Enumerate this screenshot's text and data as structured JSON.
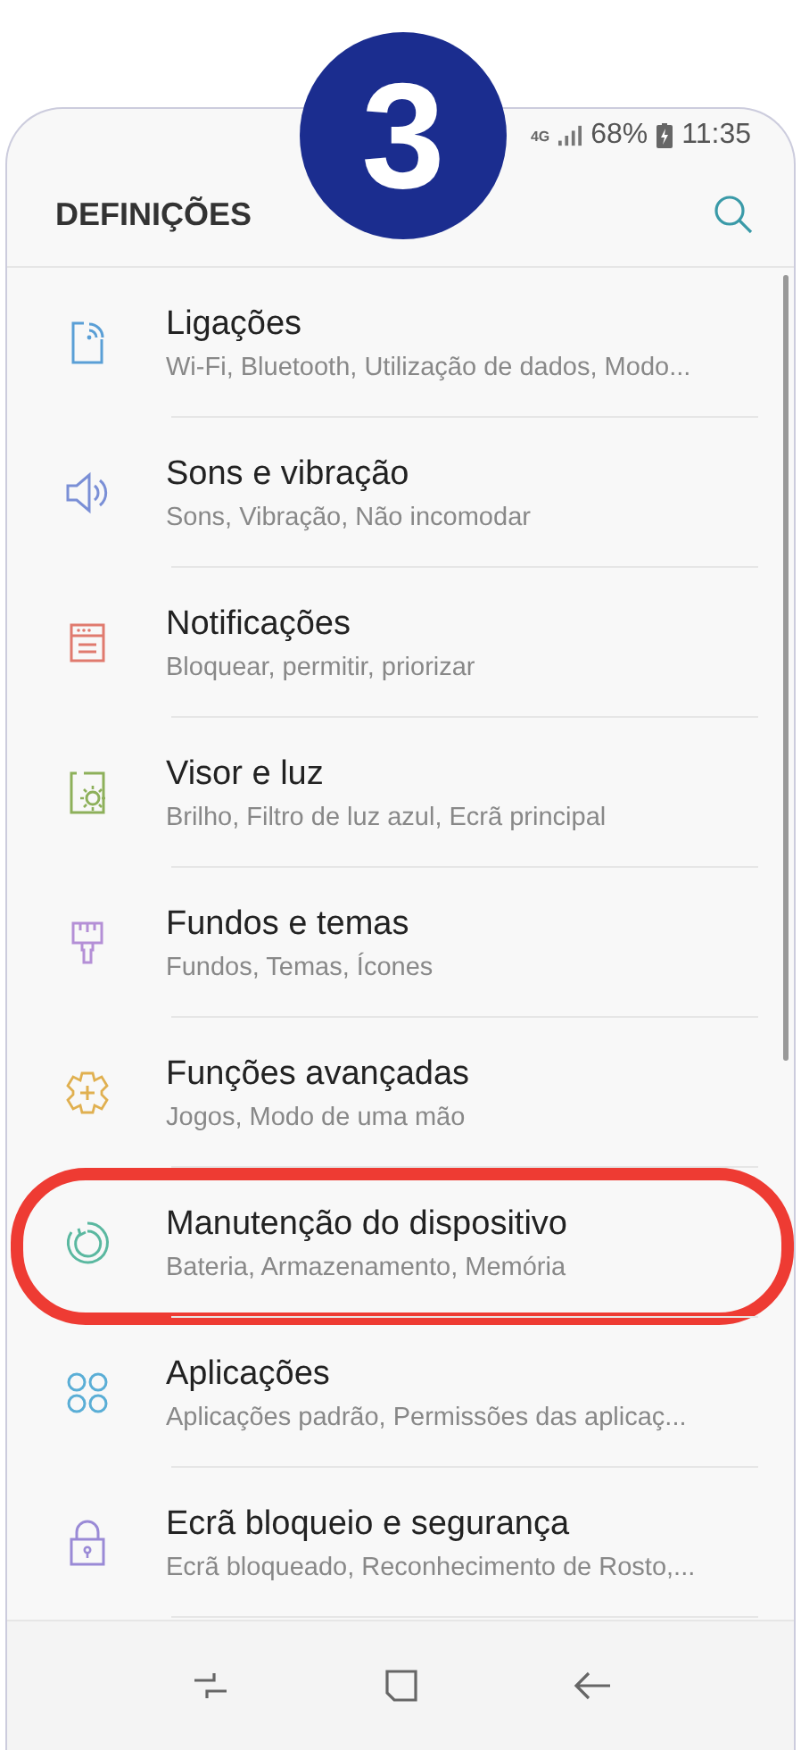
{
  "step_badge": "3",
  "status_bar": {
    "network": "4G",
    "battery": "68%",
    "time": "11:35"
  },
  "header": {
    "title": "DEFINIÇÕES"
  },
  "items": [
    {
      "title": "Ligações",
      "subtitle": "Wi-Fi, Bluetooth, Utilização de dados, Modo...",
      "color": "#5a9fd6",
      "highlighted": false
    },
    {
      "title": "Sons e vibração",
      "subtitle": "Sons, Vibração, Não incomodar",
      "color": "#7a8fd6",
      "highlighted": false
    },
    {
      "title": "Notificações",
      "subtitle": "Bloquear, permitir, priorizar",
      "color": "#e07a6e",
      "highlighted": false
    },
    {
      "title": "Visor e luz",
      "subtitle": "Brilho, Filtro de luz azul, Ecrã principal",
      "color": "#8db05a",
      "highlighted": false
    },
    {
      "title": "Fundos e temas",
      "subtitle": "Fundos, Temas, Ícones",
      "color": "#b48fd6",
      "highlighted": false
    },
    {
      "title": "Funções avançadas",
      "subtitle": "Jogos, Modo de uma mão",
      "color": "#e0b050",
      "highlighted": false
    },
    {
      "title": "Manutenção do dispositivo",
      "subtitle": "Bateria, Armazenamento, Memória",
      "color": "#5ab8a0",
      "highlighted": true
    },
    {
      "title": "Aplicações",
      "subtitle": "Aplicações padrão, Permissões das aplicaç...",
      "color": "#5aaed6",
      "highlighted": false
    },
    {
      "title": "Ecrã bloqueio e segurança",
      "subtitle": "Ecrã bloqueado, Reconhecimento de Rosto,...",
      "color": "#9a8ad6",
      "highlighted": false
    }
  ]
}
